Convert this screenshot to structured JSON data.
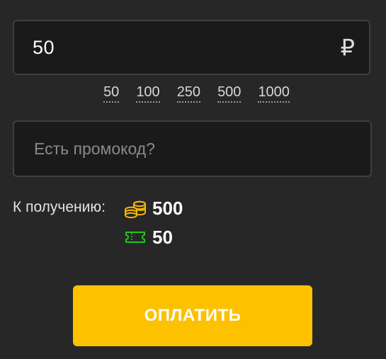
{
  "amount": {
    "value": "50",
    "currency_symbol": "₽"
  },
  "presets": [
    "50",
    "100",
    "250",
    "500",
    "1000"
  ],
  "promo": {
    "placeholder": "Есть промокод?",
    "value": ""
  },
  "receive": {
    "label": "К получению:",
    "coins": {
      "icon": "coins-icon",
      "value": "500",
      "color": "#f5b800"
    },
    "tickets": {
      "icon": "ticket-icon",
      "value": "50",
      "color": "#1ec81e"
    }
  },
  "pay_button": {
    "label": "ОПЛАТИТЬ",
    "color": "#fdc100"
  }
}
